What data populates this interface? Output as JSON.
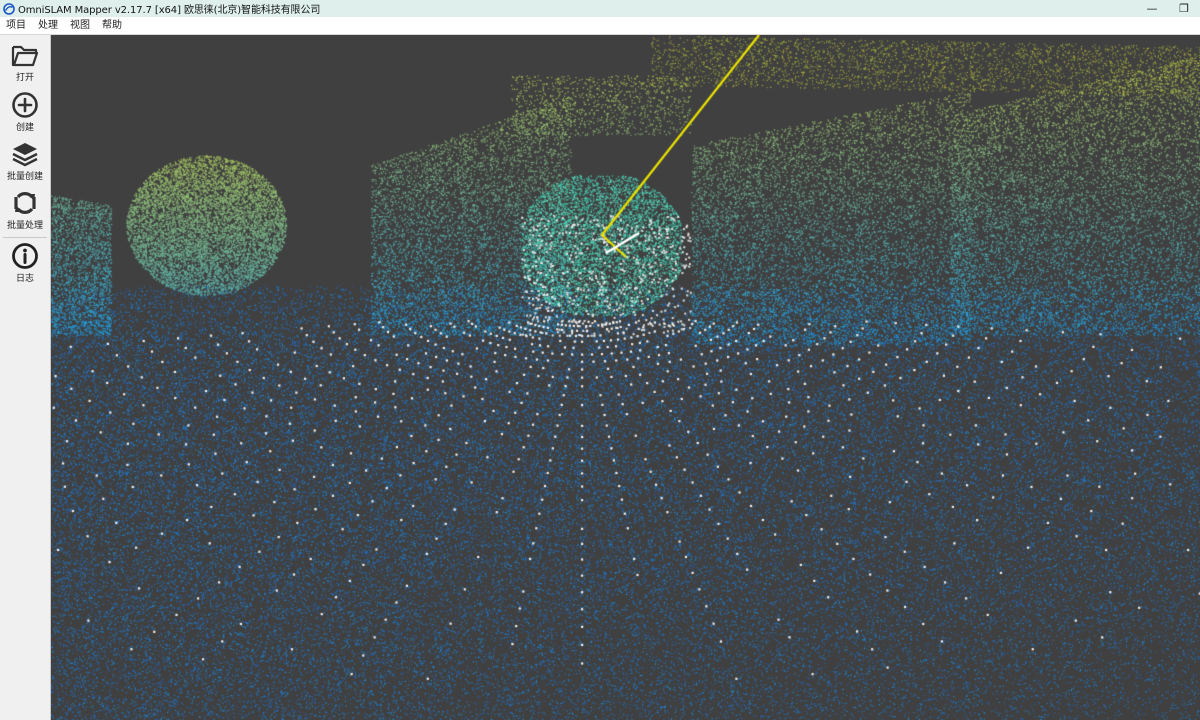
{
  "window": {
    "title": "OmniSLAM Mapper v2.17.7 [x64]   欧思徕(北京)智能科技有限公司",
    "logo_icon": "omnislam-logo-icon",
    "minimize_glyph": "—",
    "restore_glyph": "❐"
  },
  "menu": {
    "items": [
      {
        "label": "项目"
      },
      {
        "label": "处理"
      },
      {
        "label": "视图"
      },
      {
        "label": "帮助"
      }
    ]
  },
  "toolbar": {
    "items": [
      {
        "label": "打开",
        "icon": "folder-open-icon"
      },
      {
        "label": "创建",
        "icon": "plus-circle-icon"
      },
      {
        "label": "批量创建",
        "icon": "layers-icon"
      },
      {
        "label": "批量处理",
        "icon": "refresh-icon"
      },
      {
        "label": "日志",
        "icon": "info-icon"
      }
    ]
  },
  "viewport": {
    "content": "point-cloud-view",
    "background": "#404040",
    "trajectory_color": "#e8e000",
    "palette": [
      "#1a6fd8",
      "#1a9ad8",
      "#22c9c0",
      "#3ed8a0",
      "#8fd05a",
      "#c8c83a"
    ]
  }
}
